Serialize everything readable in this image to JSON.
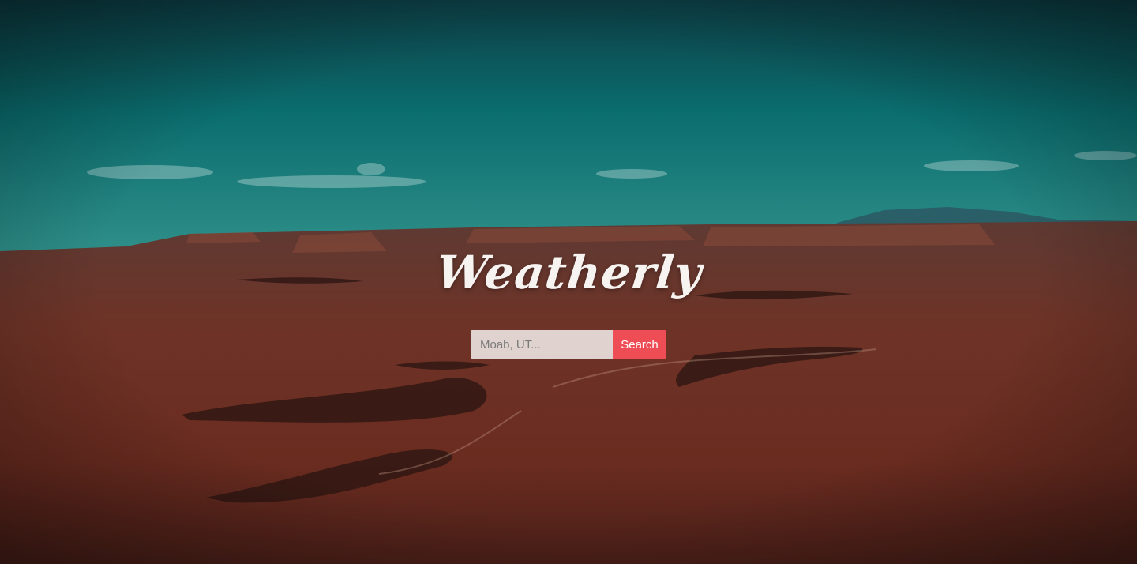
{
  "app": {
    "logo_text": "Weatherly"
  },
  "search": {
    "placeholder": "Moab, UT...",
    "value": "",
    "button_label": "Search"
  },
  "colors": {
    "accent": "#ee4d55",
    "sky": "#0b6f70",
    "terrain": "#6a2f22"
  }
}
